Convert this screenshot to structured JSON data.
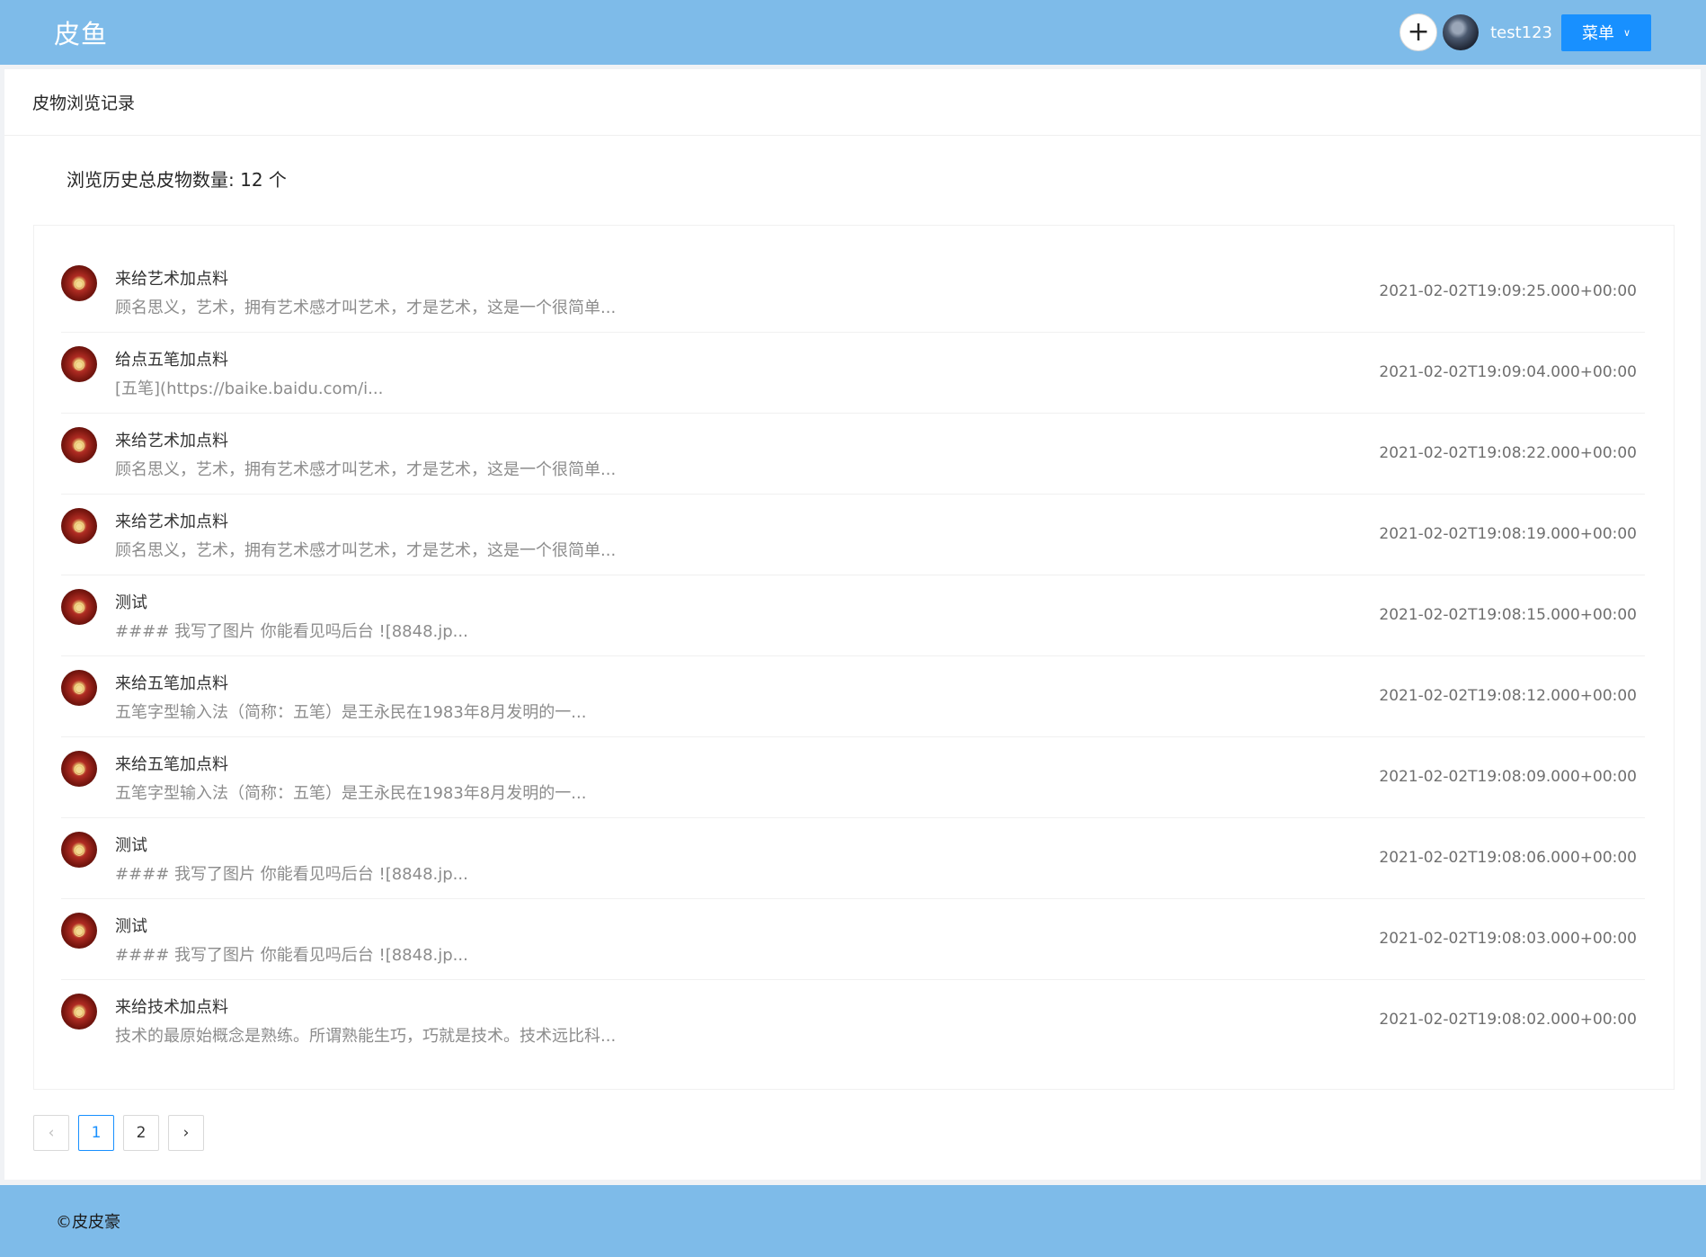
{
  "header": {
    "logo": "皮鱼",
    "add_icon": "plus-icon",
    "username": "test123",
    "menu_label": "菜单",
    "menu_icon": "chevron-down-icon"
  },
  "card": {
    "title": "皮物浏览记录",
    "total_label": "浏览历史总皮物数量: 12 个"
  },
  "history": [
    {
      "title": "来给艺术加点料",
      "desc": "顾名思义，艺术，拥有艺术感才叫艺术，才是艺术，这是一个很简单...",
      "time": "2021-02-02T19:09:25.000+00:00"
    },
    {
      "title": "给点五笔加点料",
      "desc": "[五笔](https://baike.baidu.com/i...",
      "time": "2021-02-02T19:09:04.000+00:00"
    },
    {
      "title": "来给艺术加点料",
      "desc": "顾名思义，艺术，拥有艺术感才叫艺术，才是艺术，这是一个很简单...",
      "time": "2021-02-02T19:08:22.000+00:00"
    },
    {
      "title": "来给艺术加点料",
      "desc": "顾名思义，艺术，拥有艺术感才叫艺术，才是艺术，这是一个很简单...",
      "time": "2021-02-02T19:08:19.000+00:00"
    },
    {
      "title": "测试",
      "desc": "#### 我写了图片 你能看见吗后台 ![8848.jp...",
      "time": "2021-02-02T19:08:15.000+00:00"
    },
    {
      "title": "来给五笔加点料",
      "desc": "五笔字型输入法（简称：五笔）是王永民在1983年8月发明的一...",
      "time": "2021-02-02T19:08:12.000+00:00"
    },
    {
      "title": "来给五笔加点料",
      "desc": "五笔字型输入法（简称：五笔）是王永民在1983年8月发明的一...",
      "time": "2021-02-02T19:08:09.000+00:00"
    },
    {
      "title": "测试",
      "desc": "#### 我写了图片 你能看见吗后台 ![8848.jp...",
      "time": "2021-02-02T19:08:06.000+00:00"
    },
    {
      "title": "测试",
      "desc": "#### 我写了图片 你能看见吗后台 ![8848.jp...",
      "time": "2021-02-02T19:08:03.000+00:00"
    },
    {
      "title": "来给技术加点料",
      "desc": "技术的最原始概念是熟练。所谓熟能生巧，巧就是技术。技术远比科...",
      "time": "2021-02-02T19:08:02.000+00:00"
    }
  ],
  "pagination": {
    "prev_icon": "chevron-left-icon",
    "pages": [
      "1",
      "2"
    ],
    "current": "1",
    "next_icon": "chevron-right-icon"
  },
  "footer": {
    "copyright": "©皮皮豪"
  }
}
